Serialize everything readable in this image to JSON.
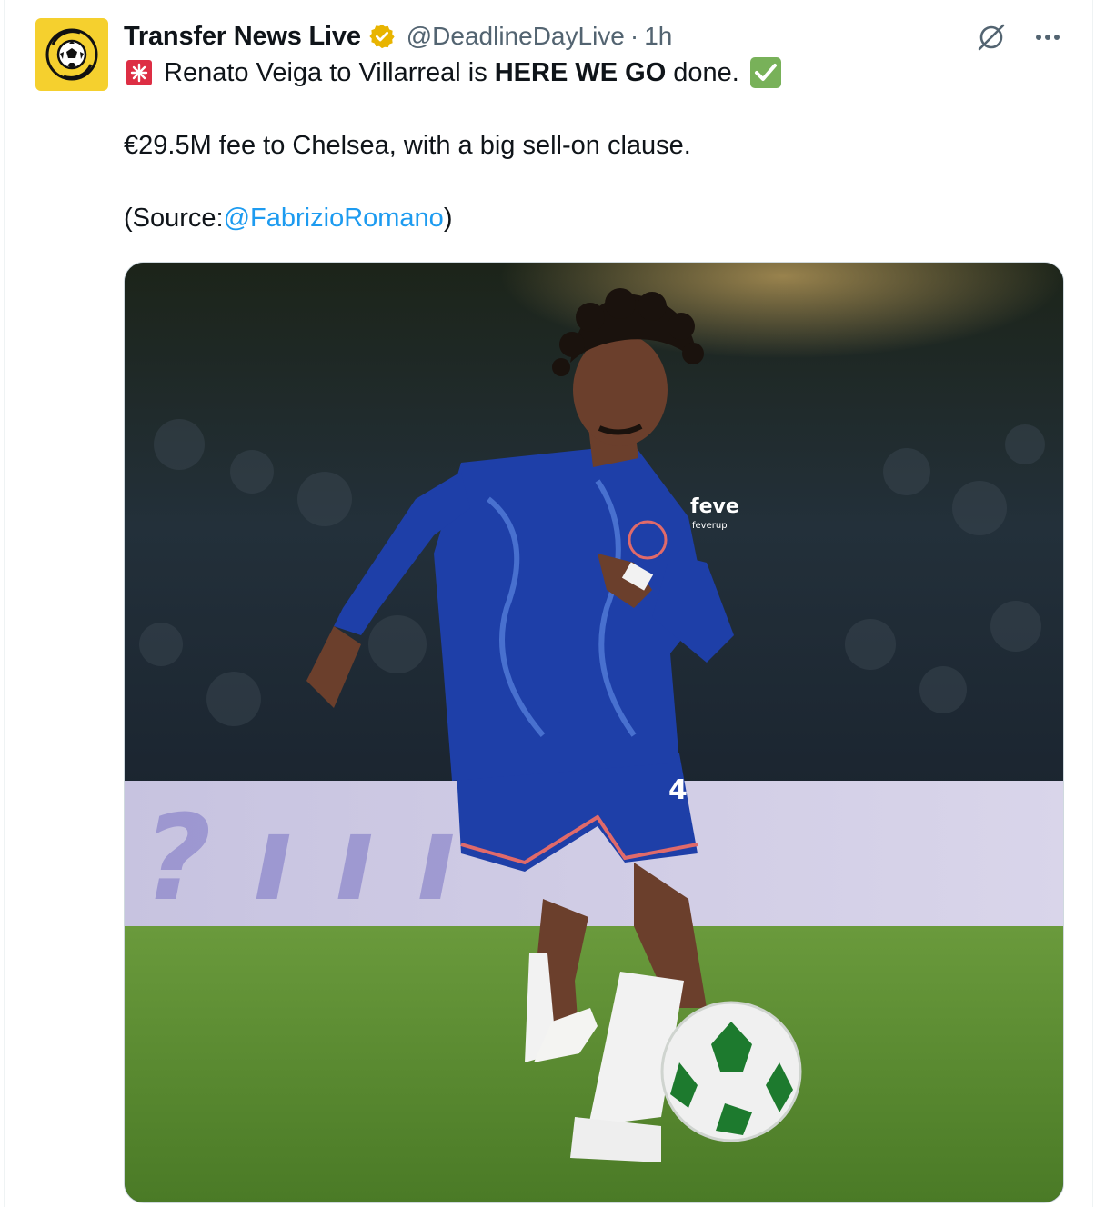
{
  "author": {
    "display_name": "Transfer News Live",
    "handle": "@DeadlineDayLive",
    "separator": "·",
    "time": "1h",
    "avatar_icon": "football-arrows-logo",
    "verified_icon": "gold-verified-badge"
  },
  "actions": {
    "grok_icon": "grok-icon",
    "more_icon": "more-icon"
  },
  "tweet": {
    "line1_prefix": "Renato Veiga to Villarreal is",
    "line1_bold": "HERE WE GO",
    "line1_suffix": "done.",
    "line2": "€29.5M fee to Chelsea, with a big sell-on clause.",
    "line3_prefix": "(Source: ",
    "line3_mention": "@FabrizioRomano",
    "line3_suffix": ")",
    "emoji_start": "siren-icon",
    "emoji_end": "check-mark-icon"
  },
  "media": {
    "jersey_sponsor": "feve",
    "jersey_sponsor_small": "feverup",
    "shorts_number": "4"
  },
  "colors": {
    "link": "#1d9bf0",
    "secondary_text": "#536471",
    "avatar_bg": "#f5d02e",
    "verified": "#e8b400",
    "check": "#78b159",
    "siren": "#dd2e44",
    "jersey": "#1e3fa8"
  }
}
